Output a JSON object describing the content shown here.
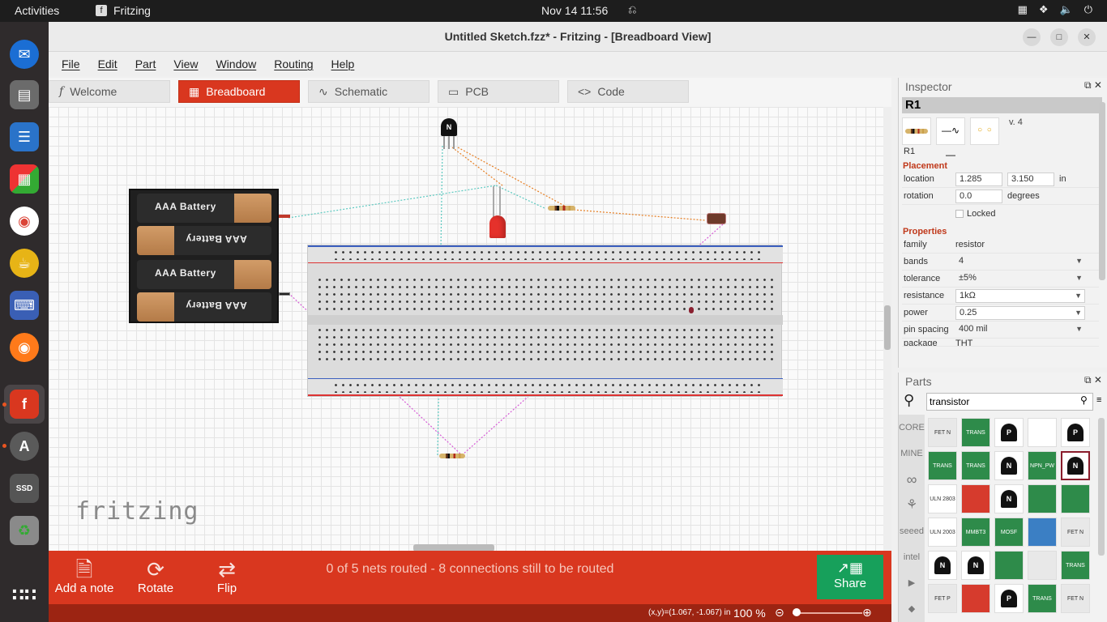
{
  "topbar": {
    "activities": "Activities",
    "app": "Fritzing",
    "clock": "Nov 14  11:56"
  },
  "window": {
    "title": "Untitled Sketch.fzz* - Fritzing - [Breadboard View]"
  },
  "menu": [
    "File",
    "Edit",
    "Part",
    "View",
    "Window",
    "Routing",
    "Help"
  ],
  "tabs": [
    {
      "label": "Welcome",
      "icon": "fritzing-f-icon"
    },
    {
      "label": "Breadboard",
      "icon": "breadboard-icon"
    },
    {
      "label": "Schematic",
      "icon": "schematic-icon"
    },
    {
      "label": "PCB",
      "icon": "pcb-icon"
    },
    {
      "label": "Code",
      "icon": "code-icon"
    }
  ],
  "canvas": {
    "battery_labels": [
      "AAA Battery",
      "AAA Battery",
      "AAA Battery",
      "AAA Battery"
    ],
    "transistor_label": "N",
    "logo": "fritzing"
  },
  "toolbar": {
    "add_note": "Add a note",
    "rotate": "Rotate",
    "flip": "Flip",
    "routing_status": "0 of 5 nets routed - 8 connections still to be routed",
    "share": "Share"
  },
  "statusbar": {
    "coords": "(x,y)=(1.067, -1.067) in",
    "zoom": "100 %"
  },
  "inspector": {
    "title": "Inspector",
    "part_title": "R1",
    "version": "v. 4",
    "part_name": "R1",
    "placement_header": "Placement",
    "location_label": "location",
    "location_x": "1.285",
    "location_y": "3.150",
    "location_unit": "in",
    "rotation_label": "rotation",
    "rotation_value": "0.0",
    "rotation_unit": "degrees",
    "locked_label": "Locked",
    "properties_header": "Properties",
    "props": [
      {
        "label": "family",
        "value": "resistor",
        "type": "static"
      },
      {
        "label": "bands",
        "value": "4",
        "type": "select"
      },
      {
        "label": "tolerance",
        "value": "±5%",
        "type": "select"
      },
      {
        "label": "resistance",
        "value": "1kΩ",
        "type": "combo"
      },
      {
        "label": "power",
        "value": "0.25",
        "type": "combo"
      },
      {
        "label": "pin spacing",
        "value": "400 mil",
        "type": "select"
      },
      {
        "label": "package",
        "value": "THT",
        "type": "select"
      }
    ]
  },
  "parts": {
    "title": "Parts",
    "search_value": "transistor",
    "bins": [
      "CORE",
      "MINE",
      "∞",
      "⚘",
      "seeed",
      "intel",
      "▶",
      "◆"
    ],
    "items": [
      {
        "label": "FET N",
        "color": "#e8e8e8"
      },
      {
        "label": "TRANS",
        "color": "#2e8b4a"
      },
      {
        "label": "P",
        "color": "#ffffff"
      },
      {
        "label": "",
        "color": "#ffffff"
      },
      {
        "label": "P",
        "color": "#ffffff"
      },
      {
        "label": "TRANS",
        "color": "#2e8b4a"
      },
      {
        "label": "TRANS",
        "color": "#2e8b4a"
      },
      {
        "label": "N",
        "color": "#ffffff"
      },
      {
        "label": "NPN_PW",
        "color": "#2e8b4a"
      },
      {
        "label": "N",
        "color": "#ffffff"
      },
      {
        "label": "ULN 2803",
        "color": "#ffffff"
      },
      {
        "label": "",
        "color": "#d63b2d"
      },
      {
        "label": "N",
        "color": "#ffffff"
      },
      {
        "label": "",
        "color": "#2e8b4a"
      },
      {
        "label": "",
        "color": "#2e8b4a"
      },
      {
        "label": "ULN 2003",
        "color": "#ffffff"
      },
      {
        "label": "MMBT3",
        "color": "#2e8b4a"
      },
      {
        "label": "MOSF",
        "color": "#2e8b4a"
      },
      {
        "label": "",
        "color": "#3b7fc4"
      },
      {
        "label": "FET N",
        "color": "#e8e8e8"
      },
      {
        "label": "N",
        "color": "#ffffff"
      },
      {
        "label": "N",
        "color": "#ffffff"
      },
      {
        "label": "",
        "color": "#2e8b4a"
      },
      {
        "label": "",
        "color": "#e8e8e8"
      },
      {
        "label": "TRANS",
        "color": "#2e8b4a"
      },
      {
        "label": "FET P",
        "color": "#e8e8e8"
      },
      {
        "label": "",
        "color": "#d63b2d"
      },
      {
        "label": "P",
        "color": "#ffffff"
      },
      {
        "label": "TRANS",
        "color": "#2e8b4a"
      },
      {
        "label": "FET N",
        "color": "#e8e8e8"
      }
    ]
  },
  "colors": {
    "accent": "#d9371f",
    "share": "#17a05b",
    "statusbar": "#9c2412"
  }
}
